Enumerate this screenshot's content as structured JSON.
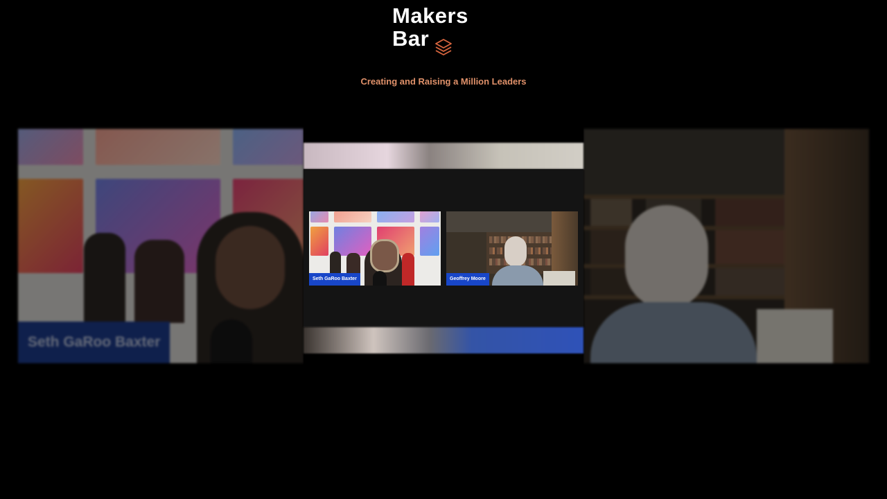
{
  "brand": {
    "line1": "Makers",
    "line2": "Bar",
    "tagline": "Creating and Raising a Million Leaders",
    "accent_color": "#e0916a",
    "icon": "stacked-layers-icon"
  },
  "participants": [
    {
      "name": "Seth GaRoo Baxter",
      "tag_color": "#1846c8"
    },
    {
      "name": "Geoffrey Moore",
      "tag_color": "#1846c8"
    }
  ]
}
